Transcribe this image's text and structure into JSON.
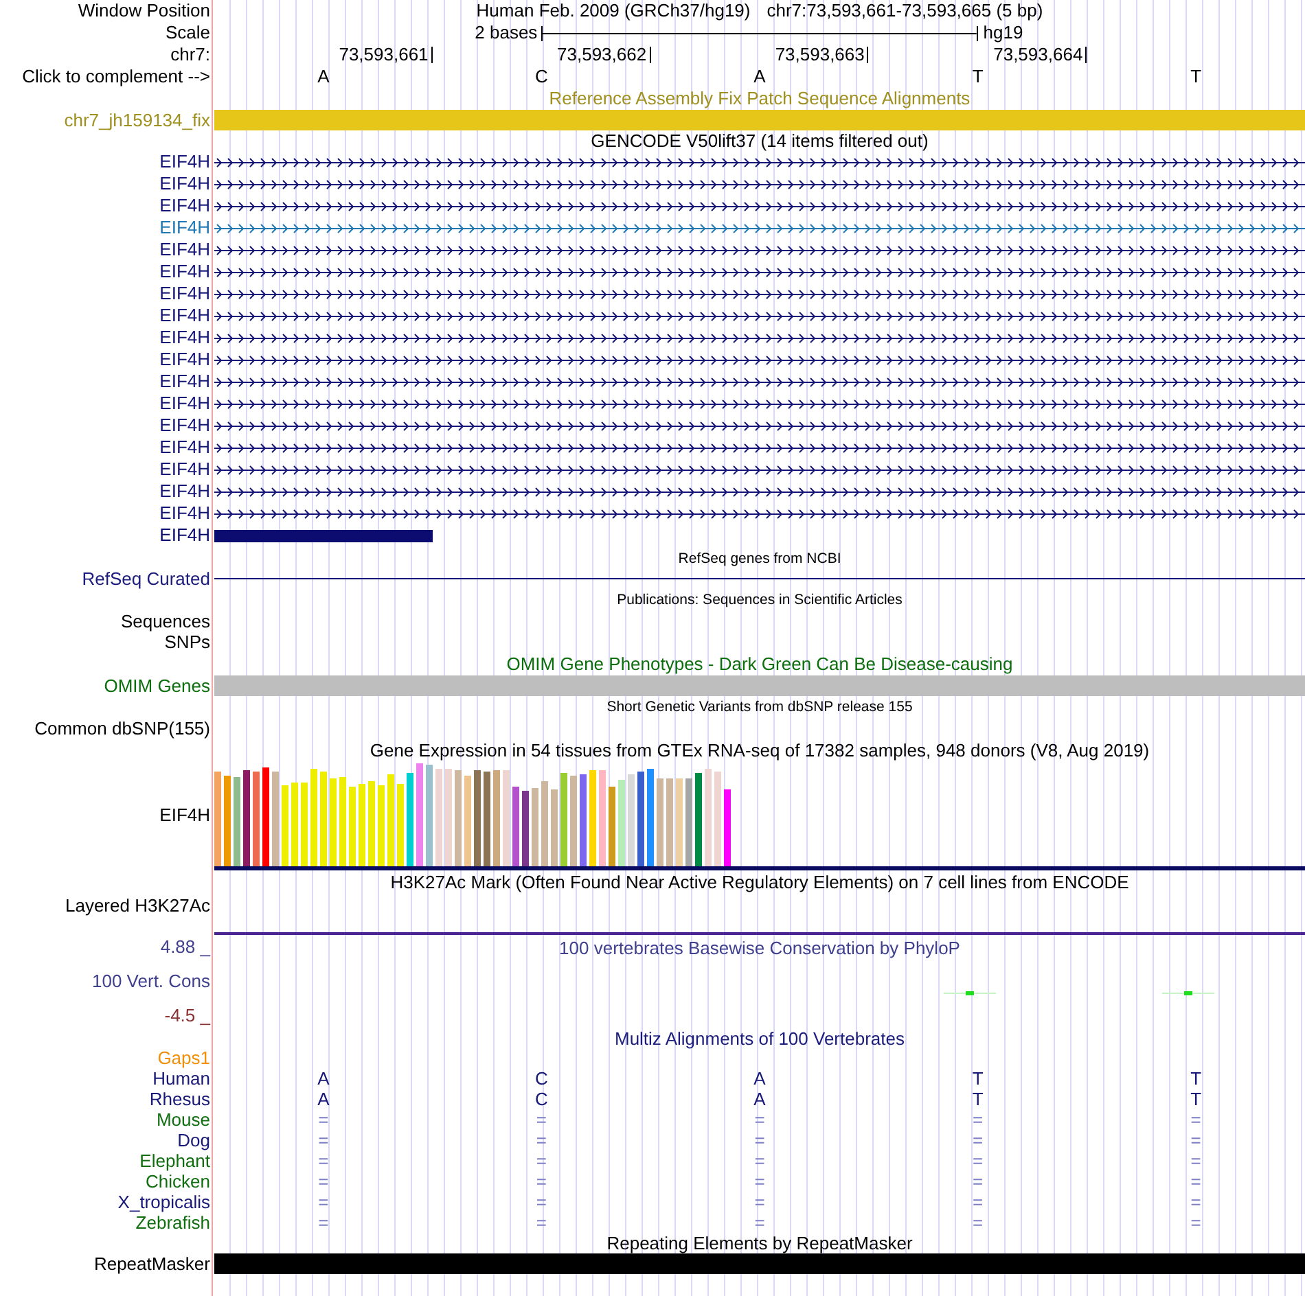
{
  "header": {
    "position": {
      "label": "Window Position",
      "assembly": "Human Feb. 2009 (GRCh37/hg19)",
      "range": "chr7:73,593,661-73,593,665 (5 bp)"
    },
    "scale": {
      "label": "Scale",
      "length": "2 bases",
      "assembly": "hg19"
    },
    "ruler": {
      "label": "chr7:",
      "ticks": [
        "73,593,661",
        "73,593,662",
        "73,593,663",
        "73,593,664"
      ]
    },
    "sequence": {
      "label": "Click to complement -->",
      "bases": [
        "A",
        "C",
        "A",
        "T",
        "T"
      ]
    }
  },
  "fix_patches": {
    "title": "Reference Assembly Fix Patch Sequence Alignments",
    "label": "chr7_jh159134_fix"
  },
  "gencode": {
    "title": "GENCODE V50lift37 (14 items filtered out)",
    "items": [
      {
        "label": "EIF4H",
        "kind": "intron",
        "color": "#161678"
      },
      {
        "label": "EIF4H",
        "kind": "intron",
        "color": "#161678"
      },
      {
        "label": "EIF4H",
        "kind": "intron",
        "color": "#161678"
      },
      {
        "label": "EIF4H",
        "kind": "intron",
        "color": "#1f78b4"
      },
      {
        "label": "EIF4H",
        "kind": "intron",
        "color": "#161678"
      },
      {
        "label": "EIF4H",
        "kind": "intron",
        "color": "#161678"
      },
      {
        "label": "EIF4H",
        "kind": "intron",
        "color": "#161678"
      },
      {
        "label": "EIF4H",
        "kind": "intron",
        "color": "#161678"
      },
      {
        "label": "EIF4H",
        "kind": "intron",
        "color": "#161678"
      },
      {
        "label": "EIF4H",
        "kind": "intron",
        "color": "#161678"
      },
      {
        "label": "EIF4H",
        "kind": "intron",
        "color": "#161678"
      },
      {
        "label": "EIF4H",
        "kind": "intron",
        "color": "#161678"
      },
      {
        "label": "EIF4H",
        "kind": "intron",
        "color": "#161678"
      },
      {
        "label": "EIF4H",
        "kind": "intron",
        "color": "#161678"
      },
      {
        "label": "EIF4H",
        "kind": "intron",
        "color": "#161678"
      },
      {
        "label": "EIF4H",
        "kind": "intron",
        "color": "#161678"
      },
      {
        "label": "EIF4H",
        "kind": "intron",
        "color": "#161678"
      },
      {
        "label": "EIF4H",
        "kind": "exon",
        "color": "#0c0c70"
      }
    ]
  },
  "refseq": {
    "title": "RefSeq genes from NCBI",
    "label": "RefSeq Curated"
  },
  "publications": {
    "title": "Publications: Sequences in Scientific Articles",
    "labels": [
      "Sequences",
      "SNPs"
    ]
  },
  "omim": {
    "title": "OMIM Gene Phenotypes - Dark Green Can Be Disease-causing",
    "label": "OMIM Genes"
  },
  "dbsnp": {
    "title": "Short Genetic Variants from dbSNP release 155",
    "label": "Common dbSNP(155)"
  },
  "gtex": {
    "title": "Gene Expression in 54 tissues from GTEx RNA-seq of 17382 samples, 948 donors (V8, Aug 2019)",
    "label": "EIF4H"
  },
  "h3k27ac": {
    "title": "H3K27Ac Mark (Often Found Near Active Regulatory Elements) on 7 cell lines from ENCODE",
    "label": "Layered H3K27Ac"
  },
  "conservation": {
    "title": "100 vertebrates Basewise Conservation by PhyloP",
    "label": "100 Vert. Cons",
    "max_label": "4.88 _",
    "min_label": "-4.5 _"
  },
  "multiz": {
    "title": "Multiz Alignments of 100 Vertebrates",
    "gaps_label": "Gaps1",
    "species": [
      {
        "name": "Human",
        "color": "#181878",
        "kind": "letters",
        "bases": [
          "A",
          "C",
          "A",
          "T",
          "T"
        ]
      },
      {
        "name": "Rhesus",
        "color": "#181878",
        "kind": "letters",
        "bases": [
          "A",
          "C",
          "A",
          "T",
          "T"
        ]
      },
      {
        "name": "Mouse",
        "color": "#106e10",
        "kind": "symbols",
        "bases": [
          "=",
          "=",
          "=",
          "=",
          "="
        ]
      },
      {
        "name": "Dog",
        "color": "#181878",
        "kind": "symbols",
        "bases": [
          "=",
          "=",
          "=",
          "=",
          "="
        ]
      },
      {
        "name": "Elephant",
        "color": "#106e10",
        "kind": "symbols",
        "bases": [
          "=",
          "=",
          "=",
          "=",
          "="
        ]
      },
      {
        "name": "Chicken",
        "color": "#106e10",
        "kind": "symbols",
        "bases": [
          "=",
          "=",
          "=",
          "=",
          "="
        ]
      },
      {
        "name": "X_tropicalis",
        "color": "#181878",
        "kind": "symbols",
        "bases": [
          "=",
          "=",
          "=",
          "=",
          "="
        ]
      },
      {
        "name": "Zebrafish",
        "color": "#106e10",
        "kind": "symbols",
        "bases": [
          "=",
          "=",
          "=",
          "=",
          "="
        ]
      }
    ]
  },
  "repeatmasker": {
    "title": "Repeating Elements by RepeatMasker",
    "label": "RepeatMasker"
  }
}
